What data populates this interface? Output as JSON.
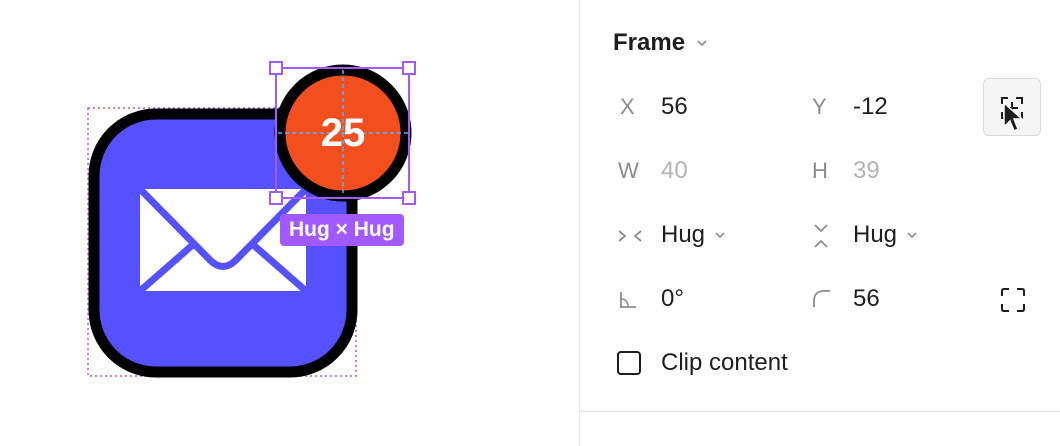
{
  "canvas": {
    "badge_count": "25",
    "size_label": "Hug × Hug",
    "colors": {
      "badge": "#f24e1e",
      "app_icon": "#5551ff",
      "selection": "#a259ff"
    }
  },
  "panel": {
    "title": "Frame",
    "x_label": "X",
    "x_value": "56",
    "y_label": "Y",
    "y_value": "-12",
    "w_label": "W",
    "w_value": "40",
    "h_label": "H",
    "h_value": "39",
    "horizontal_resizing": "Hug",
    "vertical_resizing": "Hug",
    "rotation": "0°",
    "corner_radius": "56",
    "clip_content_label": "Clip content",
    "clip_content_checked": false
  }
}
